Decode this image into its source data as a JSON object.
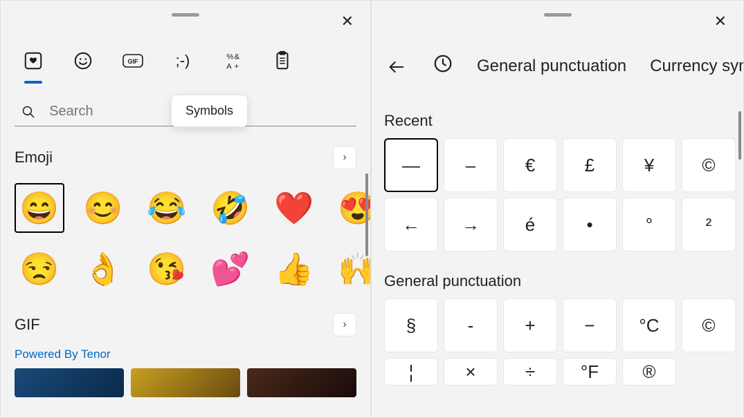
{
  "left": {
    "tabs": [
      "emoji",
      "smiley",
      "gif",
      "kaomoji",
      "symbols",
      "clipboard"
    ],
    "tooltip_label": "Symbols",
    "search_placeholder": "Search",
    "sections": {
      "emoji_title": "Emoji",
      "gif_title": "GIF",
      "gif_provider": "Powered By Tenor"
    },
    "emoji_grid": [
      "😄",
      "😊",
      "😂",
      "🤣",
      "❤️",
      "😍",
      "😒",
      "👌",
      "😘",
      "💕",
      "👍",
      "🙌"
    ]
  },
  "right": {
    "header_tabs": {
      "recent_label": "Recent",
      "general_label": "General punctuation",
      "currency_label": "Currency symbols"
    },
    "sections": {
      "recent_title": "Recent",
      "general_title": "General punctuation"
    },
    "recent_grid": [
      "—",
      "–",
      "€",
      "£",
      "¥",
      "©",
      "←",
      "→",
      "é",
      "•",
      "°",
      "²"
    ],
    "general_grid": [
      "§",
      "-",
      "+",
      "−",
      "°C",
      "©",
      "¦",
      "×",
      "÷",
      "°F",
      "®"
    ]
  }
}
